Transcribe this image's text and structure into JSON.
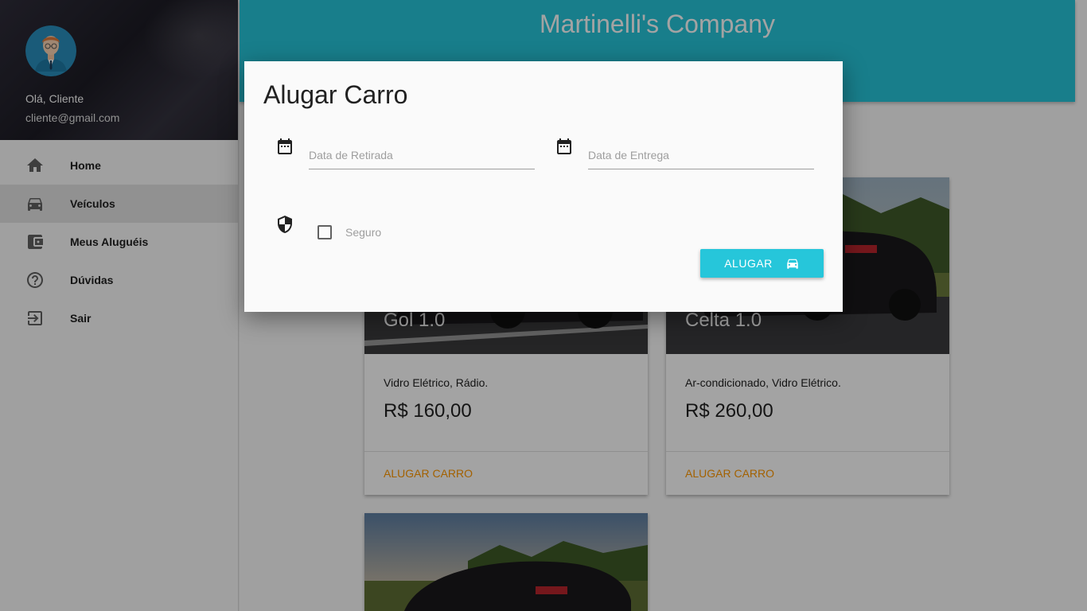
{
  "sidebar": {
    "greeting": "Olá, Cliente",
    "email": "cliente@gmail.com",
    "items": [
      {
        "label": "Home",
        "icon": "home-icon",
        "active": false
      },
      {
        "label": "Veículos",
        "icon": "car-icon",
        "active": true
      },
      {
        "label": "Meus Aluguéis",
        "icon": "wallet-icon",
        "active": false
      },
      {
        "label": "Dúvidas",
        "icon": "help-circle-icon",
        "active": false
      },
      {
        "label": "Sair",
        "icon": "exit-icon",
        "active": false
      }
    ]
  },
  "header": {
    "title": "Martinelli's Company"
  },
  "cards": [
    {
      "title": "Gol 1.0",
      "description": "Vidro Elétrico, Rádio.",
      "price": "R$ 160,00",
      "action": "ALUGAR CARRO"
    },
    {
      "title": "Celta 1.0",
      "description": "Ar-condicionado, Vidro Elétrico.",
      "price": "R$ 260,00",
      "action": "ALUGAR CARRO"
    }
  ],
  "dialog": {
    "title": "Alugar Carro",
    "pickup_placeholder": "Data de Retirada",
    "pickup_value": "",
    "return_placeholder": "Data de Entrega",
    "return_value": "",
    "insurance_label": "Seguro",
    "insurance_checked": false,
    "submit_label": "ALUGAR"
  },
  "colors": {
    "primary": "#26c6da",
    "accent": "#ff9800",
    "sidebar_header": "#2a2933"
  }
}
